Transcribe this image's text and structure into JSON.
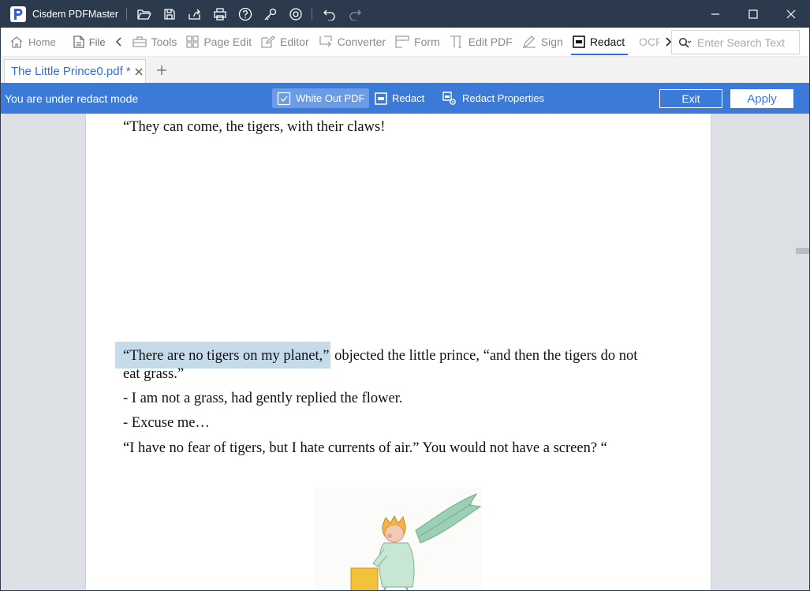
{
  "app": {
    "title": "Cisdem PDFMaster"
  },
  "toolbar": {
    "home": "Home",
    "file": "File",
    "tools": "Tools",
    "page_edit": "Page Edit",
    "editor": "Editor",
    "converter": "Converter",
    "form": "Form",
    "edit_pdf": "Edit PDF",
    "sign": "Sign",
    "redact": "Redact",
    "ocr": "OCR"
  },
  "search": {
    "placeholder": "Enter Search Text"
  },
  "tabs": {
    "document": "The Little Prince0.pdf *"
  },
  "redact_bar": {
    "status": "You are under redact mode",
    "white_out": "White Out PDF",
    "redact": "Redact",
    "properties": "Redact Properties",
    "exit": "Exit",
    "apply": "Apply"
  },
  "page": {
    "line1": "“They can come, the tigers, with their claws!",
    "highlight": "“There are no tigers on my planet,”",
    "line2_rest": " objected the little prince, “and then the tigers do not",
    "line3": "eat grass.”",
    "line4": "- I am not a grass, had gently replied the flower.",
    "line5": "- Excuse me…",
    "line6": "“I have no fear of tigers, but I hate currents of air.” You would not have a screen? “"
  },
  "colors": {
    "titlebar": "#2b3a4d",
    "accent": "#3b7ad9",
    "highlight": "#c6dbe9",
    "tab_text": "#2f6fd8"
  }
}
